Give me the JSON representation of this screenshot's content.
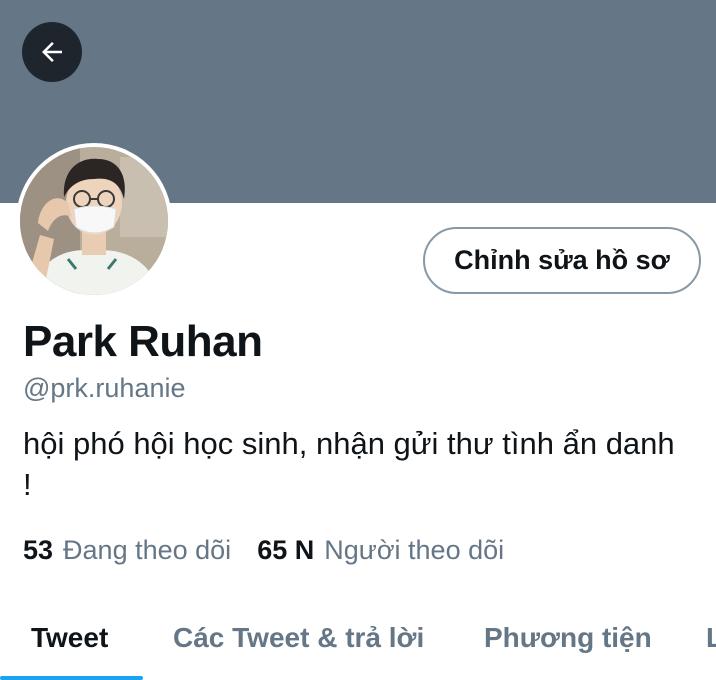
{
  "header": {
    "banner_color": "#657786",
    "back_icon": "arrow-left-icon"
  },
  "profile": {
    "avatar_icon": "avatar-photo",
    "edit_button_label": "Chỉnh sửa hồ sơ",
    "display_name": "Park Ruhan",
    "handle": "@prk.ruhanie",
    "bio": "hội phó hội học sinh, nhận gửi thư tình ẩn danh !"
  },
  "stats": {
    "following": {
      "count": "53",
      "label": "Đang theo dõi"
    },
    "followers": {
      "count": "65 N",
      "label": "Người theo dõi"
    }
  },
  "tabs": [
    {
      "label": "Tweet",
      "active": true
    },
    {
      "label": "Các Tweet & trả lời",
      "active": false
    },
    {
      "label": "Phương tiện",
      "active": false
    },
    {
      "label": "L",
      "active": false
    }
  ],
  "colors": {
    "accent": "#1da1f2",
    "text_primary": "#0f1419",
    "text_secondary": "#657786"
  }
}
